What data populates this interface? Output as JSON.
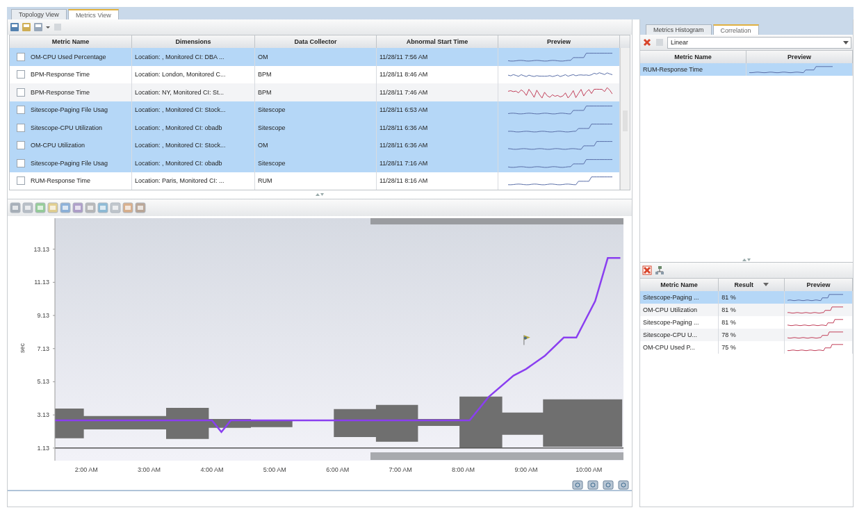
{
  "tabs": [
    {
      "label": "Topology View",
      "selected": false
    },
    {
      "label": "Metrics View",
      "selected": true
    }
  ],
  "metrics_table": {
    "columns": [
      "Metric Name",
      "Dimensions",
      "Data Collector",
      "Abnormal Start Time",
      "Preview"
    ],
    "rows": [
      {
        "metric": "OM-CPU Used Percentage",
        "dimensions": "Location: , Monitored CI: DBA ...",
        "collector": "OM",
        "start_time": "11/28/11 7:56 AM",
        "selected": true
      },
      {
        "metric": "BPM-Response Time",
        "dimensions": "Location: London, Monitored C...",
        "collector": "BPM",
        "start_time": "11/28/11 8:46 AM",
        "selected": false
      },
      {
        "metric": "BPM-Response Time",
        "dimensions": "Location: NY, Monitored CI: St...",
        "collector": "BPM",
        "start_time": "11/28/11 7:46 AM",
        "selected": false
      },
      {
        "metric": "Sitescope-Paging File Usag",
        "dimensions": "Location: , Monitored CI: Stock...",
        "collector": "Sitescope",
        "start_time": "11/28/11 6:53 AM",
        "selected": true
      },
      {
        "metric": "Sitescope-CPU Utilization",
        "dimensions": "Location: , Monitored CI: obadb",
        "collector": "Sitescope",
        "start_time": "11/28/11 6:36 AM",
        "selected": true
      },
      {
        "metric": "OM-CPU Utilization",
        "dimensions": "Location: , Monitored CI: Stock...",
        "collector": "OM",
        "start_time": "11/28/11 6:36 AM",
        "selected": true
      },
      {
        "metric": "Sitescope-Paging File Usag",
        "dimensions": "Location: , Monitored CI: obadb",
        "collector": "Sitescope",
        "start_time": "11/28/11 7:16 AM",
        "selected": true
      },
      {
        "metric": "RUM-Response Time",
        "dimensions": "Location: Paris, Monitored CI: ...",
        "collector": "RUM",
        "start_time": "11/28/11 8:16 AM",
        "selected": false
      }
    ]
  },
  "chart_data": {
    "type": "line",
    "ylabel": "sec",
    "x": [
      1.5,
      4.0,
      4.15,
      4.3,
      8.1,
      8.4,
      8.8,
      9.0,
      9.3,
      9.6,
      9.8,
      10.1,
      10.3,
      10.5
    ],
    "series": [
      {
        "color": "#8a3ff0",
        "values": [
          2.8,
          2.8,
          2.1,
          2.8,
          2.8,
          4.2,
          5.5,
          5.9,
          6.7,
          7.8,
          7.8,
          10.0,
          12.6,
          12.6
        ]
      }
    ],
    "xlim": [
      1.5,
      10.55
    ],
    "ylim": [
      0.37,
      15.0
    ],
    "xticks": [
      {
        "value": 2,
        "label": "2:00 AM"
      },
      {
        "value": 3,
        "label": "3:00 AM"
      },
      {
        "value": 4,
        "label": "4:00 AM"
      },
      {
        "value": 5,
        "label": "5:00 AM"
      },
      {
        "value": 6,
        "label": "6:00 AM"
      },
      {
        "value": 7,
        "label": "7:00 AM"
      },
      {
        "value": 8,
        "label": "8:00 AM"
      },
      {
        "value": 9,
        "label": "9:00 AM"
      },
      {
        "value": 10,
        "label": "10:00 AM"
      }
    ],
    "yticks": [
      {
        "value": 1.13,
        "label": "1.13"
      },
      {
        "value": 3.13,
        "label": "3.13"
      },
      {
        "value": 5.13,
        "label": "5.13"
      },
      {
        "value": 7.13,
        "label": "7.13"
      },
      {
        "value": 9.13,
        "label": "9.13"
      },
      {
        "value": 11.13,
        "label": "11.13"
      },
      {
        "value": 13.13,
        "label": "13.13"
      }
    ]
  },
  "side_tabs": [
    {
      "label": "Metrics Histogram",
      "selected": false
    },
    {
      "label": "Correlation",
      "selected": true
    }
  ],
  "correlation": {
    "method": "Linear",
    "columns": [
      "Metric Name",
      "Preview"
    ],
    "rows": [
      {
        "metric": "RUM-Response Time",
        "selected": true
      }
    ]
  },
  "results": {
    "columns": [
      "Metric Name",
      "Result",
      "Preview"
    ],
    "rows": [
      {
        "metric": "Sitescope-Paging ...",
        "result": "81 %",
        "selected": true
      },
      {
        "metric": "OM-CPU Utilization",
        "result": "81 %",
        "selected": false
      },
      {
        "metric": "Sitescope-Paging ...",
        "result": "81 %",
        "selected": false
      },
      {
        "metric": "Sitescope-CPU U...",
        "result": "78 %",
        "selected": false
      },
      {
        "metric": "OM-CPU Used P...",
        "result": "75 %",
        "selected": false
      }
    ]
  }
}
